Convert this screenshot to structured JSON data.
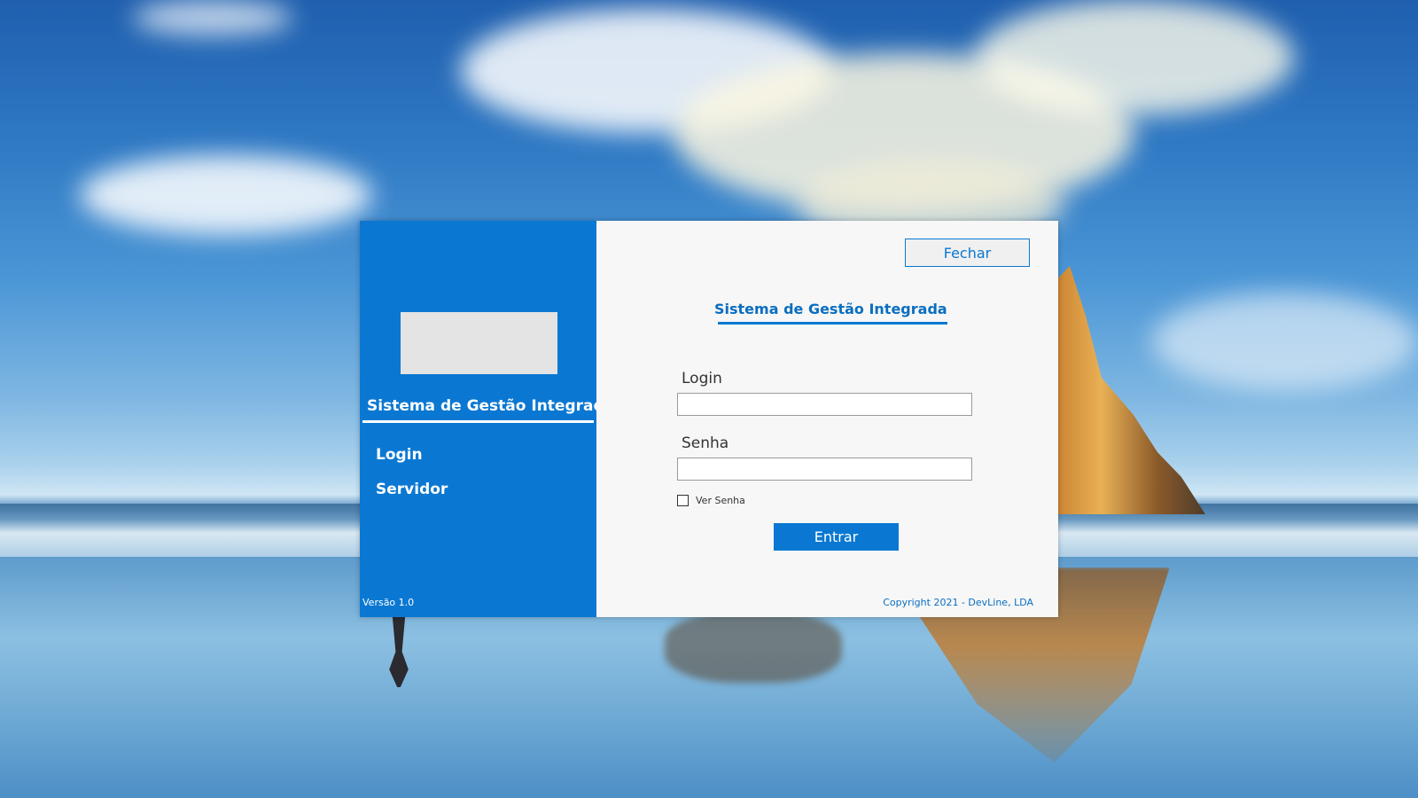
{
  "sidebar": {
    "title": "Sistema de Gestão Integrada",
    "nav": [
      {
        "label": "Login"
      },
      {
        "label": "Servidor"
      }
    ],
    "version": "Versão 1.0"
  },
  "main": {
    "close_label": "Fechar",
    "title": "Sistema de Gestão Integrada",
    "login_label": "Login",
    "login_value": "",
    "password_label": "Senha",
    "password_value": "",
    "show_password_label": "Ver Senha",
    "show_password_checked": false,
    "submit_label": "Entrar",
    "copyright": "Copyright 2021 - DevLine, LDA"
  },
  "colors": {
    "accent": "#0a78d2",
    "panel_background": "#f7f7f7",
    "logo_placeholder": "#e4e4e4"
  }
}
